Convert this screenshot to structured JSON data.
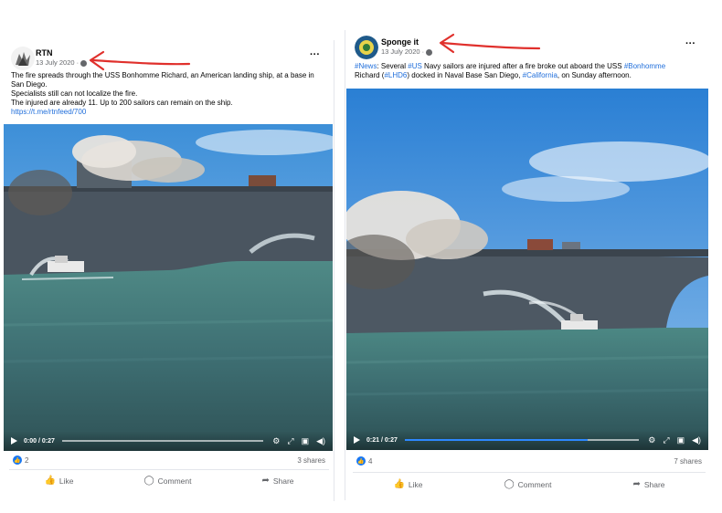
{
  "left_post": {
    "author": "RTN",
    "date": "13 July 2020 · ",
    "caption_lines": [
      "The fire spreads through the USS Bonhomme Richard, an American landing ship, at a base in San Diego.",
      " Specialists still can not localize the fire.",
      " The injured are already 11. Up to 200 sailors can remain on the ship."
    ],
    "link": "https://t.me/rtnfeed/700",
    "video_time": "0:00 / 0:27",
    "progress": 0,
    "reactions": "2",
    "shares": "3 shares",
    "actions": {
      "like": "Like",
      "comment": "Comment",
      "share": "Share"
    }
  },
  "right_post": {
    "author": "Sponge it",
    "date": "13 July 2020 · ",
    "caption": {
      "t1": "#News",
      "t2": ": Several ",
      "t3": "#US",
      "t4": " Navy sailors are injured after a fire broke out aboard the USS ",
      "t5": "#Bonhomme",
      "t6": "Richard (",
      "t7": "#LHD6",
      "t8": ") docked in Naval Base San Diego, ",
      "t9": "#California",
      "t10": ", on Sunday afternoon."
    },
    "video_time": "0:21 / 0:27",
    "progress": 0.78,
    "reactions": "4",
    "shares": "7 shares",
    "actions": {
      "like": "Like",
      "comment": "Comment",
      "share": "Share"
    }
  },
  "colors": {
    "accent": "#1877f2",
    "hashtag": "#216fdb",
    "annotation_arrow": "#e0302c"
  },
  "icons": [
    "globe-icon",
    "more-icon",
    "play-icon",
    "settings-icon",
    "fullscreen-icon",
    "volume-icon",
    "thumbs-up-icon",
    "comment-icon",
    "share-icon"
  ]
}
